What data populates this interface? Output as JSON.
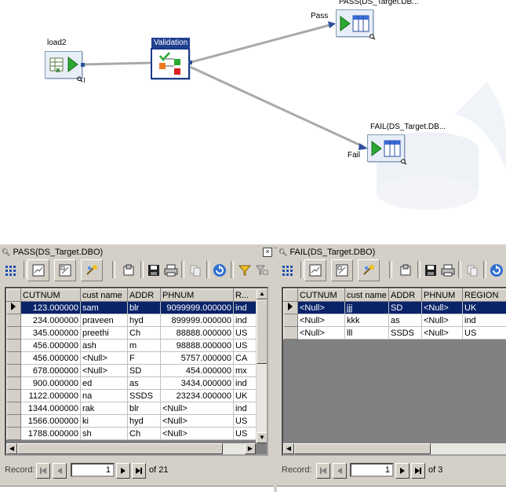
{
  "canvas": {
    "nodes": {
      "load2": {
        "label": "load2"
      },
      "validation": {
        "label": "Validation"
      },
      "pass": {
        "label": "PASS(DS_Target.DB..."
      },
      "fail": {
        "label": "FAIL(DS_Target.DB..."
      }
    },
    "links": {
      "pass_label": "Pass",
      "fail_label": "Fail"
    },
    "colors": {
      "link": "#a9a9a9",
      "selected_border": "#1a3a8a",
      "play_green": "#2aa832"
    }
  },
  "pass_panel": {
    "title": "PASS(DS_Target.DBO)",
    "close_label": "×",
    "toolbar": [
      "grid-view-icon",
      "form-view-icon",
      "edit-view-icon",
      "config-icon",
      "export-icon",
      "save-icon",
      "print-icon",
      "copy-icon",
      "refresh-icon",
      "filter-icon",
      "filter-settings-icon"
    ],
    "columns": [
      "CUTNUM",
      "cust name",
      "ADDR",
      "PHNUM",
      "R..."
    ],
    "rows": [
      [
        "123.000000",
        "sam",
        "blr",
        "9099999.000000",
        "ind"
      ],
      [
        "234.000000",
        "praveen",
        "hyd",
        "899999.000000",
        "ind"
      ],
      [
        "345.000000",
        "preethi",
        "Ch",
        "88888.000000",
        "US"
      ],
      [
        "456.000000",
        "ash",
        "m",
        "98888.000000",
        "US"
      ],
      [
        "456.000000",
        "<Null>",
        "F",
        "5757.000000",
        "CA"
      ],
      [
        "678.000000",
        "<Null>",
        "SD",
        "454.000000",
        "mx"
      ],
      [
        "900.000000",
        "ed",
        "as",
        "3434.000000",
        "ind"
      ],
      [
        "1122.000000",
        "na",
        "SSDS",
        "23234.000000",
        "UK"
      ],
      [
        "1344.000000",
        "rak",
        "blr",
        "<Null>",
        "ind"
      ],
      [
        "1566.000000",
        "ki",
        "hyd",
        "<Null>",
        "US"
      ],
      [
        "1788.000000",
        "sh",
        "Ch",
        "<Null>",
        "US"
      ]
    ],
    "record_label": "Record:",
    "record_value": "1",
    "record_total": "of 21"
  },
  "fail_panel": {
    "title": "FAIL(DS_Target.DBO)",
    "columns": [
      "CUTNUM",
      "cust name",
      "ADDR",
      "PHNUM",
      "REGION"
    ],
    "rows": [
      [
        "<Null>",
        "jjj",
        "SD",
        "<Null>",
        "UK"
      ],
      [
        "<Null>",
        "kkk",
        "as",
        "<Null>",
        "ind"
      ],
      [
        "<Null>",
        "lll",
        "SSDS",
        "<Null>",
        "US"
      ]
    ],
    "record_label": "Record:",
    "record_value": "1",
    "record_total": "of 3"
  },
  "colors": {
    "selection": "#0a246a",
    "chrome": "#d4d0c8",
    "grid_empty": "#808080"
  }
}
